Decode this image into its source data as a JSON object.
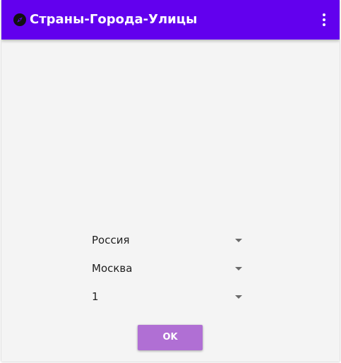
{
  "app_bar": {
    "title": "Страны-Города-Улицы",
    "icon": "compass-icon",
    "menu_icon": "more-vertical-icon",
    "color": "#6200ee"
  },
  "form": {
    "country_spinner": {
      "value": "Россия"
    },
    "city_spinner": {
      "value": "Москва"
    },
    "street_spinner": {
      "value": "1"
    },
    "ok_label": "OK"
  },
  "colors": {
    "background": "#f4f4f4",
    "button": "#b06fd4"
  }
}
